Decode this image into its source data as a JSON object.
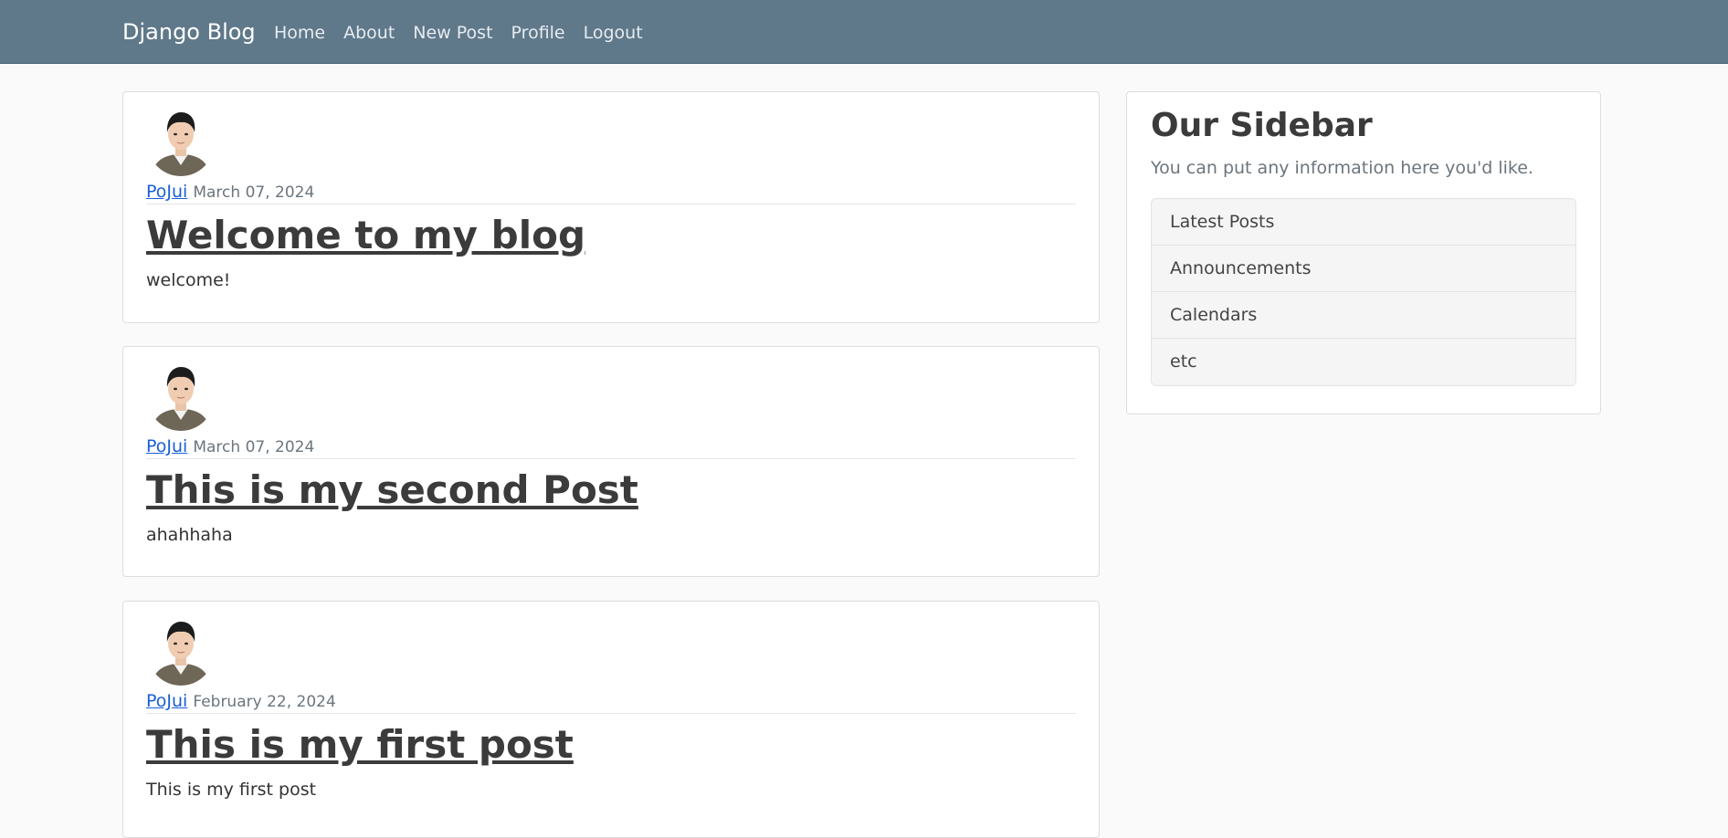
{
  "navbar": {
    "brand": "Django Blog",
    "links": [
      {
        "label": "Home"
      },
      {
        "label": "About"
      },
      {
        "label": "New Post"
      },
      {
        "label": "Profile"
      },
      {
        "label": "Logout"
      }
    ]
  },
  "posts": [
    {
      "author": "PoJui",
      "date": "March 07, 2024",
      "title": "Welcome to my blog",
      "content": "welcome!"
    },
    {
      "author": "PoJui",
      "date": "March 07, 2024",
      "title": "This is my second Post",
      "content": "ahahhaha"
    },
    {
      "author": "PoJui",
      "date": "February 22, 2024",
      "title": "This is my first post",
      "content": "This is my first post"
    }
  ],
  "sidebar": {
    "title": "Our Sidebar",
    "text": "You can put any information here you'd like.",
    "items": [
      {
        "label": "Latest Posts"
      },
      {
        "label": "Announcements"
      },
      {
        "label": "Calendars"
      },
      {
        "label": "etc"
      }
    ]
  },
  "colors": {
    "navbar_bg": "#5f788a",
    "link": "#1a5fd6",
    "page_bg": "#fafafa"
  }
}
